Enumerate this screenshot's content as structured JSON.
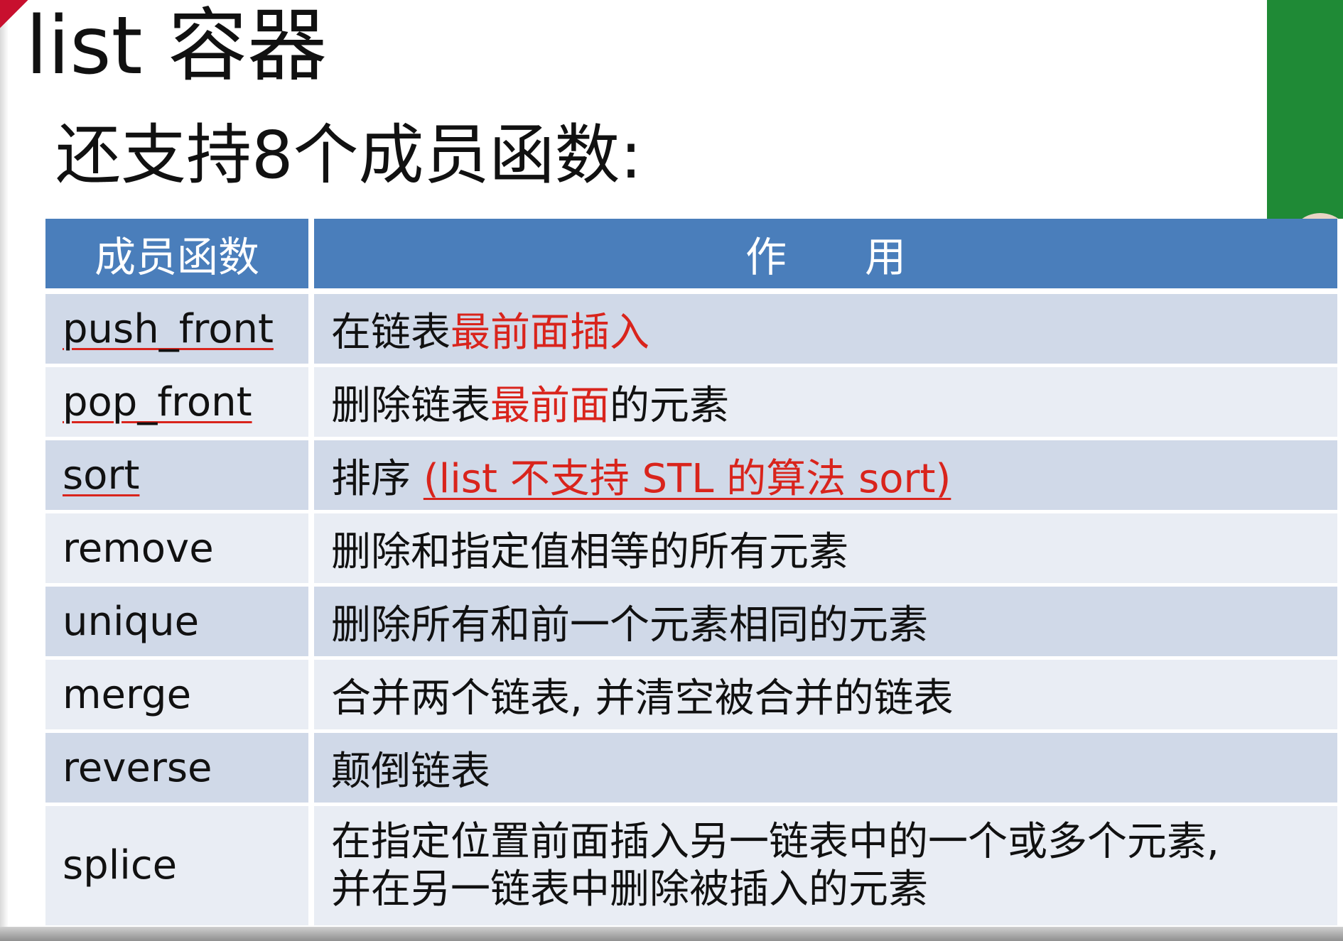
{
  "slide": {
    "title": "list 容器",
    "subtitle": "还支持8个成员函数:"
  },
  "table": {
    "headers": {
      "function": "成员函数",
      "purpose": "作用"
    },
    "rows": [
      {
        "function": "push_front",
        "desc_plain": "在链表",
        "desc_highlight": "最前面插入",
        "desc_tail": ""
      },
      {
        "function": "pop_front",
        "desc_plain": "删除链表",
        "desc_highlight": "最前面",
        "desc_tail": "的元素"
      },
      {
        "function": "sort",
        "desc_plain": "排序 ",
        "desc_highlight": "(list 不支持 STL 的算法 sort)",
        "desc_tail": ""
      },
      {
        "function": "remove",
        "desc_plain": "删除和指定值相等的所有元素",
        "desc_highlight": "",
        "desc_tail": ""
      },
      {
        "function": "unique",
        "desc_plain": "删除所有和前一个元素相同的元素",
        "desc_highlight": "",
        "desc_tail": ""
      },
      {
        "function": "merge",
        "desc_plain": "合并两个链表, 并清空被合并的链表",
        "desc_highlight": "",
        "desc_tail": ""
      },
      {
        "function": "reverse",
        "desc_plain": "颠倒链表",
        "desc_highlight": "",
        "desc_tail": ""
      },
      {
        "function": "splice",
        "desc_line1": "在指定位置前面插入另一链表中的一个或多个元素,",
        "desc_line2": "并在另一链表中删除被插入的元素"
      }
    ]
  },
  "colors": {
    "header_bg": "#4a7ebb",
    "row_odd": "#d0d9e8",
    "row_even": "#e9edf4",
    "highlight_text": "#d9241c",
    "video_bg": "#1f8a36"
  }
}
